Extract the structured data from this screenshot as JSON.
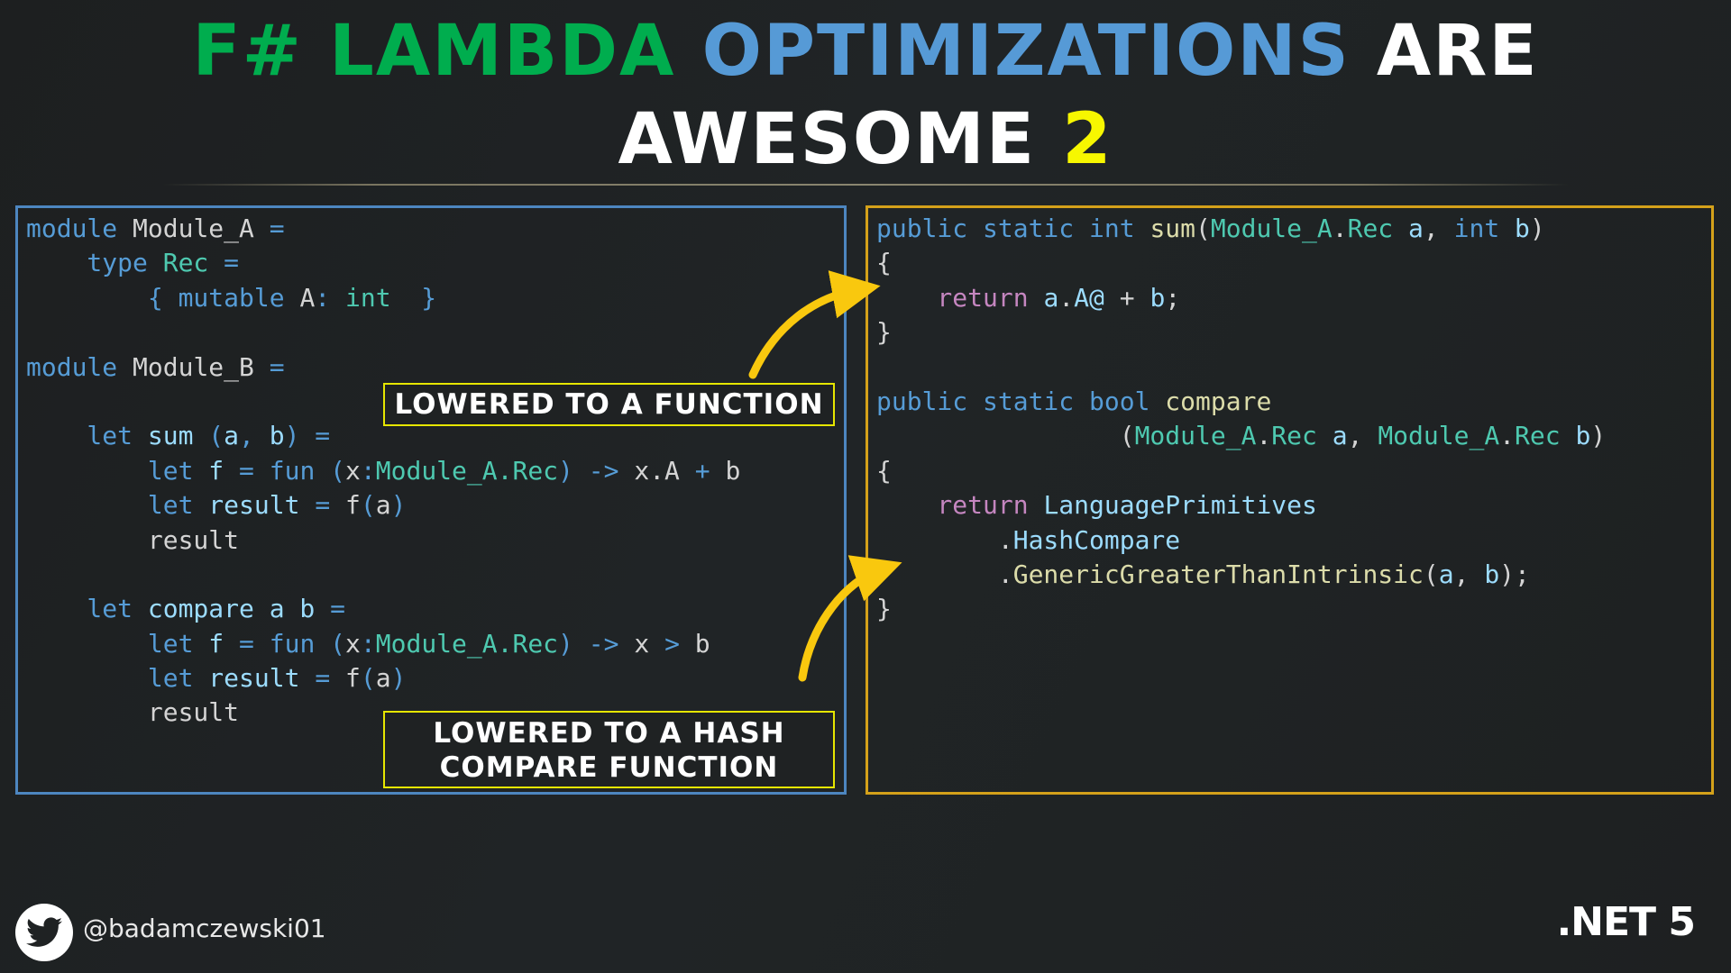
{
  "title": {
    "line1": [
      {
        "text": "F# LAMBDA ",
        "color": "#00ad4e"
      },
      {
        "text": "OPTIMIZATIONS ",
        "color": "#569ad6"
      },
      {
        "text": "ARE",
        "color": "#ffffff"
      }
    ],
    "line2": [
      {
        "text": "AWESOME ",
        "color": "#ffffff"
      },
      {
        "text": "2",
        "color": "#f7f700"
      }
    ]
  },
  "colors": {
    "left_border": "#4d86c0",
    "right_border": "#d4a11a",
    "arrow": "#f9c80e",
    "label_border": "#e6e600"
  },
  "fsharp_code": [
    [
      [
        "kw",
        "module "
      ],
      [
        "pl",
        "Module_A "
      ],
      [
        "kw",
        "="
      ]
    ],
    [
      [
        "kw",
        "    type "
      ],
      [
        "ty",
        "Rec "
      ],
      [
        "kw",
        "="
      ]
    ],
    [
      [
        "kw",
        "        { mutable "
      ],
      [
        "pl",
        "A"
      ],
      [
        "kw",
        ": "
      ],
      [
        "ty",
        "int"
      ],
      [
        "kw",
        "  }"
      ]
    ],
    [],
    [
      [
        "kw",
        "module "
      ],
      [
        "pl",
        "Module_B "
      ],
      [
        "kw",
        "="
      ]
    ],
    [],
    [
      [
        "kw",
        "    let "
      ],
      [
        "id",
        "sum "
      ],
      [
        "kw",
        "("
      ],
      [
        "id",
        "a"
      ],
      [
        "kw",
        ", "
      ],
      [
        "id",
        "b"
      ],
      [
        "kw",
        ") ="
      ]
    ],
    [
      [
        "kw",
        "        let "
      ],
      [
        "id",
        "f "
      ],
      [
        "kw",
        "= fun ("
      ],
      [
        "pl",
        "x"
      ],
      [
        "kw",
        ":"
      ],
      [
        "ty",
        "Module_A.Rec"
      ],
      [
        "kw",
        ") -> "
      ],
      [
        "pl",
        "x.A "
      ],
      [
        "kw",
        "+ "
      ],
      [
        "pl",
        "b"
      ]
    ],
    [
      [
        "kw",
        "        let "
      ],
      [
        "id",
        "result "
      ],
      [
        "kw",
        "= "
      ],
      [
        "pl",
        "f"
      ],
      [
        "kw",
        "("
      ],
      [
        "pl",
        "a"
      ],
      [
        "kw",
        ")"
      ]
    ],
    [
      [
        "pl",
        "        result"
      ]
    ],
    [],
    [
      [
        "kw",
        "    let "
      ],
      [
        "id",
        "compare a b "
      ],
      [
        "kw",
        "="
      ]
    ],
    [
      [
        "kw",
        "        let "
      ],
      [
        "id",
        "f "
      ],
      [
        "kw",
        "= fun ("
      ],
      [
        "pl",
        "x"
      ],
      [
        "kw",
        ":"
      ],
      [
        "ty",
        "Module_A.Rec"
      ],
      [
        "kw",
        ") -> "
      ],
      [
        "pl",
        "x "
      ],
      [
        "kw",
        "> "
      ],
      [
        "pl",
        "b"
      ]
    ],
    [
      [
        "kw",
        "        let "
      ],
      [
        "id",
        "result "
      ],
      [
        "kw",
        "= "
      ],
      [
        "pl",
        "f"
      ],
      [
        "kw",
        "("
      ],
      [
        "pl",
        "a"
      ],
      [
        "kw",
        ")"
      ]
    ],
    [
      [
        "pl",
        "        result"
      ]
    ]
  ],
  "csharp_code": [
    [
      [
        "kw",
        "public static int "
      ],
      [
        "fn",
        "sum"
      ],
      [
        "pl",
        "("
      ],
      [
        "ty",
        "Module_A"
      ],
      [
        "pl",
        "."
      ],
      [
        "ty",
        "Rec "
      ],
      [
        "id",
        "a"
      ],
      [
        "pl",
        ", "
      ],
      [
        "kw",
        "int "
      ],
      [
        "id",
        "b"
      ],
      [
        "pl",
        ")"
      ]
    ],
    [
      [
        "pl",
        "{"
      ]
    ],
    [
      [
        "rt",
        "    return "
      ],
      [
        "id",
        "a"
      ],
      [
        "pl",
        "."
      ],
      [
        "id",
        "A@ "
      ],
      [
        "pl",
        "+ "
      ],
      [
        "id",
        "b"
      ],
      [
        "pl",
        ";"
      ]
    ],
    [
      [
        "pl",
        "}"
      ]
    ],
    [],
    [
      [
        "kw",
        "public static bool "
      ],
      [
        "fn",
        "compare"
      ]
    ],
    [
      [
        "pl",
        "                ("
      ],
      [
        "ty",
        "Module_A"
      ],
      [
        "pl",
        "."
      ],
      [
        "ty",
        "Rec "
      ],
      [
        "id",
        "a"
      ],
      [
        "pl",
        ", "
      ],
      [
        "ty",
        "Module_A"
      ],
      [
        "pl",
        "."
      ],
      [
        "ty",
        "Rec "
      ],
      [
        "id",
        "b"
      ],
      [
        "pl",
        ")"
      ]
    ],
    [
      [
        "pl",
        "{"
      ]
    ],
    [
      [
        "rt",
        "    return "
      ],
      [
        "id",
        "LanguagePrimitives"
      ]
    ],
    [
      [
        "pl",
        "        ."
      ],
      [
        "id",
        "HashCompare"
      ]
    ],
    [
      [
        "pl",
        "        ."
      ],
      [
        "fn",
        "GenericGreaterThanIntrinsic"
      ],
      [
        "pl",
        "("
      ],
      [
        "id",
        "a"
      ],
      [
        "pl",
        ", "
      ],
      [
        "id",
        "b"
      ],
      [
        "pl",
        ");"
      ]
    ],
    [
      [
        "pl",
        "}"
      ]
    ]
  ],
  "annotations": {
    "label1": "LOWERED TO A FUNCTION",
    "label2_line1": "LOWERED TO A HASH",
    "label2_line2": "COMPARE FUNCTION"
  },
  "footer": {
    "twitter_icon": "twitter-bird-icon",
    "handle": "@badamczewski01",
    "badge": ".NET 5"
  }
}
